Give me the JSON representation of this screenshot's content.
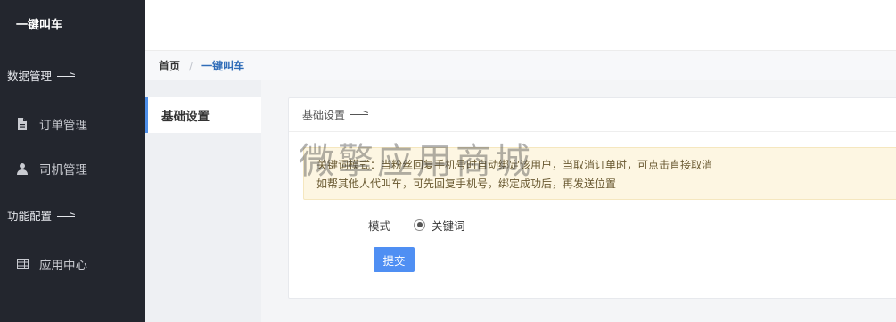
{
  "sidebar": {
    "brand": "一键叫车",
    "groups": [
      {
        "title": "数据管理"
      },
      {
        "title": "功能配置"
      }
    ],
    "items": [
      {
        "label": "订单管理",
        "icon": "file-icon"
      },
      {
        "label": "司机管理",
        "icon": "user-icon"
      },
      {
        "label": "应用中心",
        "icon": "grid-icon"
      }
    ]
  },
  "breadcrumb": {
    "home": "首页",
    "separator": "/",
    "current": "一键叫车"
  },
  "submenu": {
    "items": [
      {
        "label": "基础设置",
        "active": true
      }
    ]
  },
  "panel": {
    "title": "基础设置",
    "notice": {
      "line1": "关键词模式：当粉丝回复手机号时自动绑定该用户，当取消订单时，可点击直接取消",
      "line2": "如帮其他人代叫车，可先回复手机号，绑定成功后，再发送位置"
    },
    "form": {
      "mode_label": "模式",
      "mode_value": "关键词"
    },
    "submit_label": "提交"
  },
  "watermark": "微擎应用商城",
  "colors": {
    "sidebar_bg": "#23262e",
    "accent": "#4f8ff3",
    "breadcrumb_current": "#2f6cb8",
    "notice_bg": "#fdf6e2"
  }
}
